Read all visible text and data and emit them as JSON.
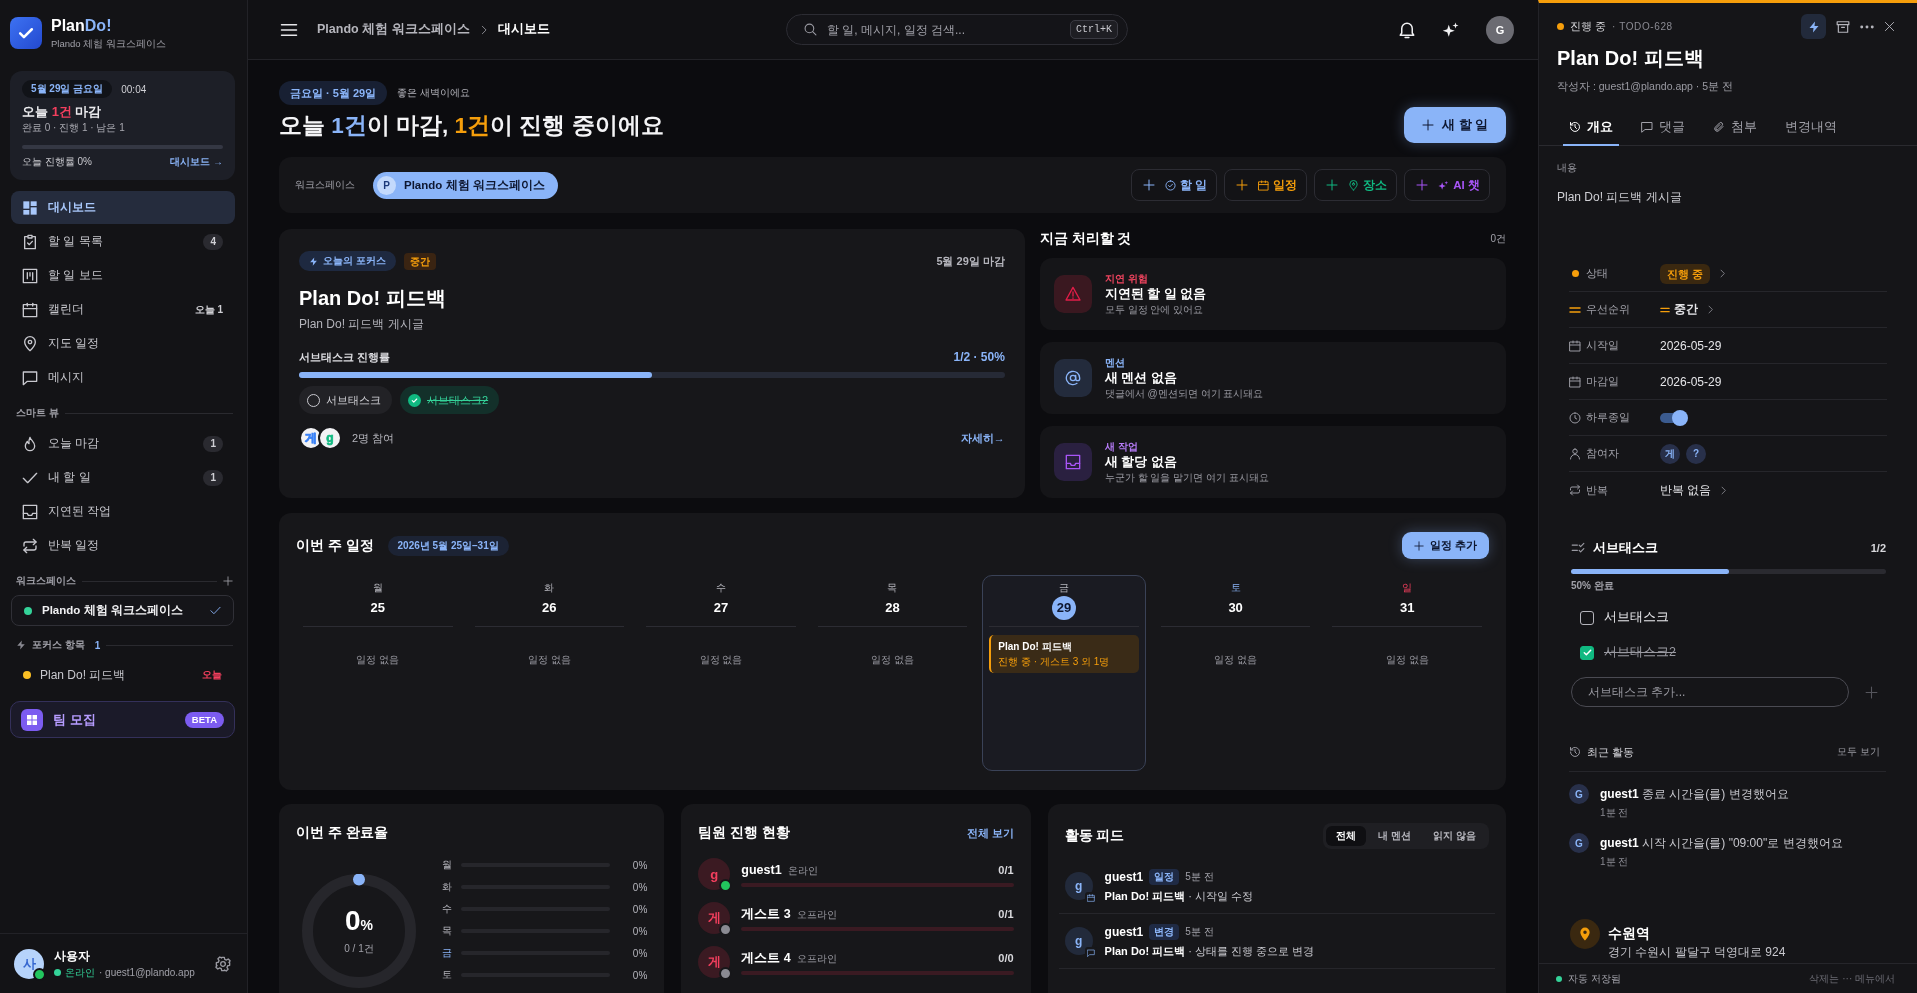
{
  "sidebar": {
    "brand": {
      "name": "Plan",
      "name_accent": "Do!",
      "workspace": "Plando 체험 워크스페이스"
    },
    "today": {
      "date": "5월 29일 금요일",
      "time": "00:04",
      "headline": [
        {
          "text": "오늘 "
        },
        {
          "text": "1건",
          "kind": "alert"
        },
        {
          "text": " 마감"
        }
      ],
      "summary": "완료 0 · 진행 1 · 남은 1",
      "level": 0,
      "progress_label": "오늘 진행률 0%",
      "link": "대시보드 →"
    },
    "nav": [
      {
        "label": "대시보드",
        "selected": true
      },
      {
        "label": "할 일 목록",
        "selected": false,
        "badge": {
          "text": "4",
          "kind": "pill"
        }
      },
      {
        "label": "할 일 보드",
        "selected": false
      },
      {
        "label": "캘린더",
        "selected": false,
        "badge": {
          "text": "오늘 1",
          "kind": "plain"
        }
      },
      {
        "label": "지도 일정",
        "selected": false
      },
      {
        "label": "메시지",
        "selected": false
      }
    ],
    "smart_view": {
      "title": "스마트 뷰",
      "items": [
        {
          "label": "오늘 마감",
          "selected": false,
          "badge": {
            "text": "1",
            "kind": "pill"
          }
        },
        {
          "label": "내 할 일",
          "selected": false,
          "badge": {
            "text": "1",
            "kind": "pill"
          }
        },
        {
          "label": "지연된 작업",
          "selected": false
        },
        {
          "label": "반복 일정",
          "selected": false
        }
      ]
    },
    "workspaces": {
      "title": "워크스페이스",
      "items": [
        {
          "name": "Plando 체험 워크스페이스",
          "selected": true
        }
      ]
    },
    "focus": {
      "title": "포커스 항목",
      "count": "1",
      "items": [
        {
          "label": "Plan Do! 피드백",
          "due": "오늘"
        }
      ]
    },
    "team_recruit": {
      "label": "팀 모집",
      "badge": "BETA"
    },
    "user": {
      "initial": "사",
      "name": "사용자",
      "status": "온라인",
      "email": "· guest1@plando.app",
      "online": true
    }
  },
  "header": {
    "breadcrumb": [
      "Plando 체험 워크스페이스",
      "대시보드"
    ],
    "search": {
      "placeholder": "할 일, 메시지, 일정 검색...",
      "shortcut": "Ctrl+K"
    },
    "avatar": "G"
  },
  "dashboard": {
    "date": "금요일 · 5월 29일",
    "greeting": "좋은 새벽이에요",
    "headline": [
      {
        "text": "오늘 "
      },
      {
        "text": "1건",
        "kind": "due"
      },
      {
        "text": "이 마감, "
      },
      {
        "text": "1건",
        "kind": "progress"
      },
      {
        "text": "이 진행 중이에요"
      }
    ],
    "new_button": "새 할 일",
    "workspace_bar": {
      "label": "워크스페이스",
      "workspace": {
        "initial": "P",
        "name": "Plando 체험 워크스페이스"
      },
      "actions": [
        {
          "kind": "task",
          "label": "할 일",
          "color": "#8ab4f8"
        },
        {
          "kind": "event",
          "label": "일정",
          "color": "#f59e0b"
        },
        {
          "kind": "place",
          "label": "장소",
          "color": "#10b981"
        },
        {
          "kind": "ai",
          "label": "AI 챗",
          "color": "#a855f7"
        }
      ]
    },
    "focus_card": {
      "tag": "오늘의 포커스",
      "priority": "중간",
      "due": "5월 29일 마감",
      "title": "Plan Do! 피드백",
      "description": "Plan Do! 피드백 게시글",
      "progress_label": "서브태스크 진행률",
      "progress_reading": "1/2 · 50%",
      "level": 0.5,
      "subtasks": [
        {
          "label": "서브태스크",
          "checked": false
        },
        {
          "label": "서브태스크2",
          "checked": true
        }
      ],
      "participants": [
        {
          "initial": "게",
          "color": "#3b82f6"
        },
        {
          "initial": "g",
          "color": "#10b981"
        }
      ],
      "participants_label": "2명 참여",
      "link": "자세히→"
    },
    "action_now": {
      "title": "지금 처리할 것",
      "count": "0건",
      "cards": [
        {
          "kind": "overdue",
          "label": "지연 위험",
          "title": "지연된 할 일 없음",
          "description": "모두 일정 안에 있어요"
        },
        {
          "kind": "mention",
          "label": "멘션",
          "title": "새 멘션 없음",
          "description": "댓글에서 @멘션되면 여기 표시돼요"
        },
        {
          "kind": "assigned",
          "label": "새 작업",
          "title": "새 할당 없음",
          "description": "누군가 할 일을 맡기면 여기 표시돼요"
        }
      ]
    },
    "week": {
      "title": "이번 주 일정",
      "range": "2026년 5월 25일–31일",
      "add_button": "일정 추가",
      "days": [
        {
          "weekday": "월",
          "date": "25",
          "kind": "weekday",
          "selected": false,
          "empty": "일정 없음"
        },
        {
          "weekday": "화",
          "date": "26",
          "kind": "weekday",
          "selected": false,
          "empty": "일정 없음"
        },
        {
          "weekday": "수",
          "date": "27",
          "kind": "weekday",
          "selected": false,
          "empty": "일정 없음"
        },
        {
          "weekday": "목",
          "date": "28",
          "kind": "weekday",
          "selected": false,
          "empty": "일정 없음"
        },
        {
          "weekday": "금",
          "date": "29",
          "kind": "weekday",
          "selected": true,
          "events": [
            {
              "title": "Plan Do! 피드백",
              "meta": "진행 중 · 게스트 3 외 1명"
            }
          ]
        },
        {
          "weekday": "토",
          "date": "30",
          "kind": "saturday",
          "selected": false,
          "empty": "일정 없음"
        },
        {
          "weekday": "일",
          "date": "31",
          "kind": "sunday",
          "selected": false,
          "empty": "일정 없음"
        }
      ]
    },
    "completion": {
      "title": "이번 주 완료율",
      "value": "0",
      "unit": "%",
      "detail": "0 / 1건",
      "days": [
        {
          "day": "월",
          "level": 0,
          "reading": "0%",
          "today": false
        },
        {
          "day": "화",
          "level": 0,
          "reading": "0%",
          "today": false
        },
        {
          "day": "수",
          "level": 0,
          "reading": "0%",
          "today": false
        },
        {
          "day": "목",
          "level": 0,
          "reading": "0%",
          "today": false
        },
        {
          "day": "금",
          "level": 0,
          "reading": "0%",
          "today": true
        },
        {
          "day": "토",
          "level": 0,
          "reading": "0%",
          "today": false
        }
      ]
    },
    "team": {
      "title": "팀원 진행 현황",
      "link": "전체 보기",
      "members": [
        {
          "initial": "g",
          "name": "guest1",
          "status": "온라인",
          "online": true,
          "reading": "0/1",
          "level": 0
        },
        {
          "initial": "게",
          "name": "게스트 3",
          "status": "오프라인",
          "online": false,
          "reading": "0/1",
          "level": 0
        },
        {
          "initial": "게",
          "name": "게스트 4",
          "status": "오프라인",
          "online": false,
          "reading": "0/0",
          "level": 0
        }
      ]
    },
    "feed": {
      "title": "활동 피드",
      "filters": [
        {
          "label": "전체",
          "selected": true
        },
        {
          "label": "내 멘션",
          "selected": false
        },
        {
          "label": "읽지 않음",
          "selected": false
        }
      ],
      "items": [
        {
          "kind": "event",
          "initial": "g",
          "user": "guest1",
          "tag": "일정",
          "time": "5분 전",
          "text": "**Plan Do! 피드백** · 시작일 수정"
        },
        {
          "kind": "change",
          "initial": "g",
          "user": "guest1",
          "tag": "변경",
          "time": "5분 전",
          "text": "**Plan Do! 피드백** · 상태를 진행 중으로 변경"
        }
      ]
    }
  },
  "detail": {
    "status": "진행 중",
    "code": "· TODO-628",
    "title": "Plan Do! 피드백",
    "author": "작성자 : guest1@plando.app · 5분 전",
    "tabs": [
      {
        "label": "개요",
        "selected": true
      },
      {
        "label": "댓글",
        "selected": false
      },
      {
        "label": "첨부",
        "selected": false
      },
      {
        "label": "변경내역",
        "selected": false
      }
    ],
    "content_label": "내용",
    "content": "Plan Do! 피드백 게시글",
    "properties": [
      {
        "kind": "status",
        "label": "상태",
        "value": "진행 중"
      },
      {
        "kind": "priority",
        "label": "우선순위",
        "value": "중간"
      },
      {
        "kind": "date",
        "label": "시작일",
        "value": "2026-05-29"
      },
      {
        "kind": "date",
        "label": "마감일",
        "value": "2026-05-29"
      },
      {
        "kind": "toggle",
        "label": "하루종일",
        "on": true
      },
      {
        "kind": "people",
        "label": "참여자",
        "people": [
          "게",
          "?"
        ]
      },
      {
        "kind": "repeat",
        "label": "반복",
        "value": "반복 없음"
      }
    ],
    "subtasks": {
      "title": "서브태스크",
      "count": "1/2",
      "level": 0.5,
      "reading": "50% 완료",
      "items": [
        {
          "label": "서브태스크",
          "checked": false
        },
        {
          "label": "서브태스크2",
          "checked": true
        }
      ],
      "placeholder": "서브태스크 추가..."
    },
    "activity": {
      "title": "최근 활동",
      "link": "모두 보기",
      "items": [
        {
          "initial": "G",
          "text": "**guest1** 종료 시간을(를) 변경했어요",
          "time": "1분 전"
        },
        {
          "initial": "G",
          "text": "**guest1** 시작 시간을(를) \"09:00\"로 변경했어요",
          "time": "1분 전"
        }
      ]
    },
    "location": {
      "name": "수원역",
      "address": "경기 수원시 팔달구 덕영대로 924"
    },
    "footer": {
      "saved": "자동 저장됨",
      "hint": "삭제는 ··· 메뉴에서"
    }
  }
}
